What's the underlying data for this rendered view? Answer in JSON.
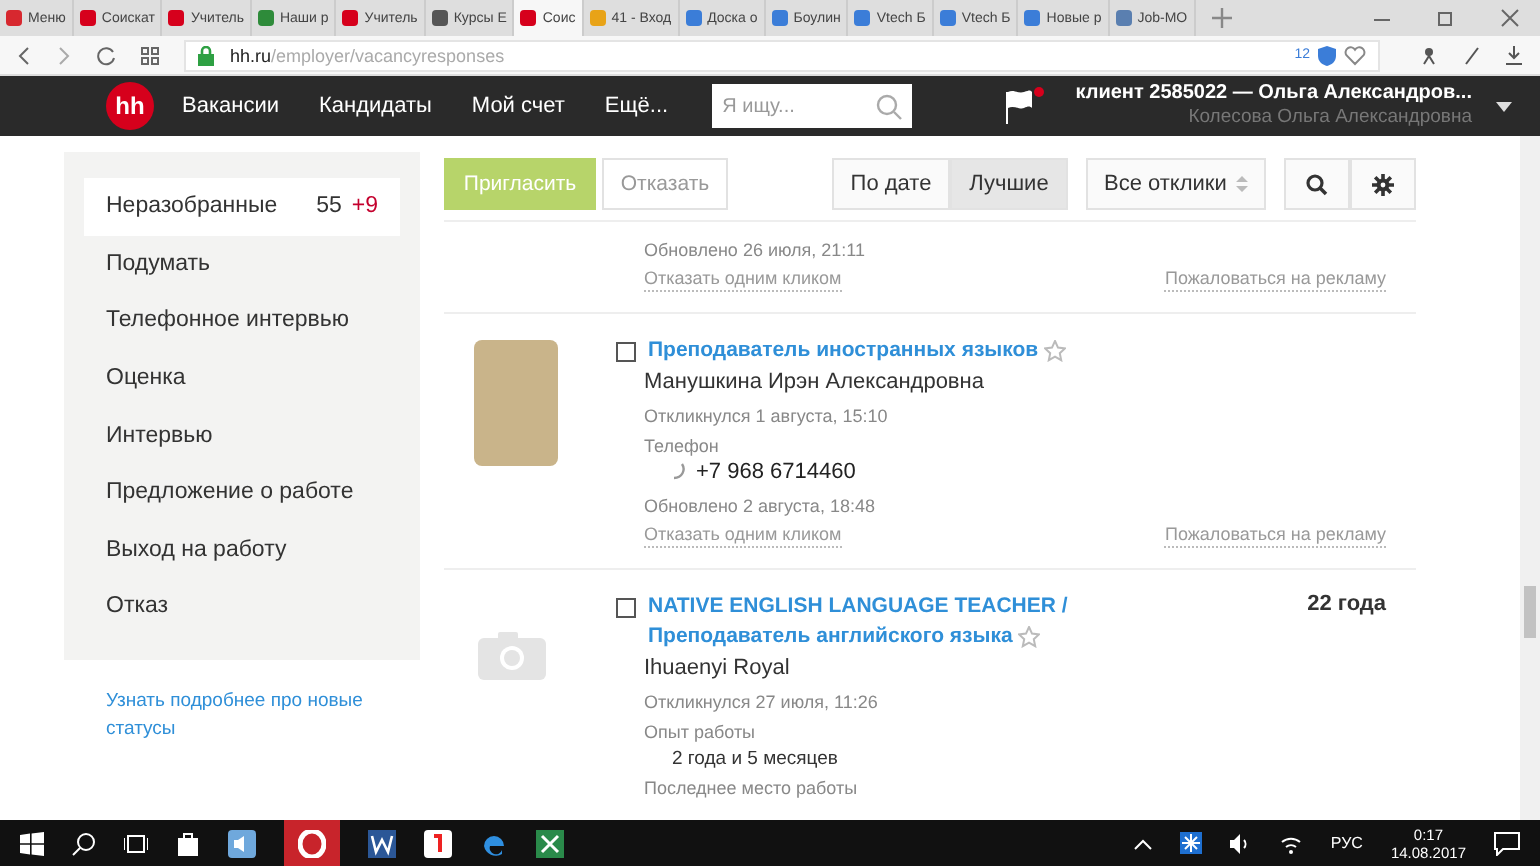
{
  "browser": {
    "tabs": [
      {
        "label": "Меню",
        "selected": false,
        "color": "#d7282f"
      },
      {
        "label": "Соискат",
        "selected": false,
        "color": "#d6001c"
      },
      {
        "label": "Учитель",
        "selected": false,
        "color": "#d6001c"
      },
      {
        "label": "Наши р",
        "selected": false,
        "color": "#2e8b3a"
      },
      {
        "label": "Учитель",
        "selected": false,
        "color": "#d6001c"
      },
      {
        "label": "Курсы Е",
        "selected": false,
        "color": "#555555"
      },
      {
        "label": "Соис",
        "selected": true,
        "color": "#d6001c"
      },
      {
        "label": "41 - Вход",
        "selected": false,
        "color": "#e8a317"
      },
      {
        "label": "Доска о",
        "selected": false,
        "color": "#3b7dd8"
      },
      {
        "label": "Боулин",
        "selected": false,
        "color": "#3b7dd8"
      },
      {
        "label": "Vtech Б",
        "selected": false,
        "color": "#3b7dd8"
      },
      {
        "label": "Vtech Б",
        "selected": false,
        "color": "#3b7dd8"
      },
      {
        "label": "Новые р",
        "selected": false,
        "color": "#3b7dd8"
      },
      {
        "label": "Job-МО",
        "selected": false,
        "color": "#5a7fb0"
      }
    ],
    "address": {
      "host": "hh.ru",
      "path": "/employer/vacancyresponses"
    },
    "badge": "12"
  },
  "nav": {
    "logo": "hh",
    "items": [
      "Вакансии",
      "Кандидаты",
      "Мой счет",
      "Ещё..."
    ],
    "search": {
      "placeholder": "Я ищу..."
    },
    "account": {
      "title": "клиент 2585022 — Ольга Александров...",
      "subtitle": "Колесова Ольга Александровна"
    }
  },
  "sidebar": {
    "items": [
      {
        "label": "Неразобранные",
        "count": "55",
        "new_count": "+9",
        "selected": true
      },
      {
        "label": "Подумать",
        "selected": false
      },
      {
        "label": "Телефонное интервью",
        "selected": false
      },
      {
        "label": "Оценка",
        "selected": false
      },
      {
        "label": "Интервью",
        "selected": false
      },
      {
        "label": "Предложение о работе",
        "selected": false
      },
      {
        "label": "Выход на работу",
        "selected": false
      },
      {
        "label": "Отказ",
        "selected": false
      }
    ],
    "link": "Узнать подробнее про новые статусы"
  },
  "toolbar": {
    "invite": "Пригласить",
    "reject": "Отказать",
    "sort": [
      {
        "label": "По дате",
        "selected": false
      },
      {
        "label": "Лучшие",
        "selected": true
      }
    ],
    "filter": "Все отклики"
  },
  "responses": [
    {
      "kind": "partial",
      "updated": "Обновлено 26 июля, 21:11",
      "reject_link": "Отказать одним кликом",
      "report_link": "Пожаловаться на рекламу"
    },
    {
      "kind": "full",
      "has_photo": true,
      "checked": false,
      "starred": false,
      "title": "Преподаватель иностранных языков",
      "name": "Манушкина Ирэн Александровна",
      "responded": "Откликнулся 1 августа, 15:10",
      "details": [
        {
          "kind": "phone",
          "label": "Телефон",
          "value": "+7 968 6714460"
        }
      ],
      "updated": "Обновлено 2 августа, 18:48",
      "reject_link": "Отказать одним кликом",
      "report_link": "Пожаловаться на рекламу"
    },
    {
      "kind": "full",
      "has_photo": false,
      "checked": false,
      "starred": false,
      "title_lines": [
        "NATIVE ENGLISH LANGUAGE TEACHER /",
        "Преподаватель английского языка"
      ],
      "age": "22 года",
      "name": "Ihuaenyi Royal",
      "responded": "Откликнулся 27 июля, 11:26",
      "details": [
        {
          "kind": "text",
          "label": "Опыт работы",
          "value": "2 года и 5 месяцев"
        },
        {
          "kind": "heading",
          "label": "Последнее место работы"
        }
      ]
    }
  ],
  "taskbar": {
    "lang": "РУС",
    "time": "0:17",
    "date": "14.08.2017"
  }
}
